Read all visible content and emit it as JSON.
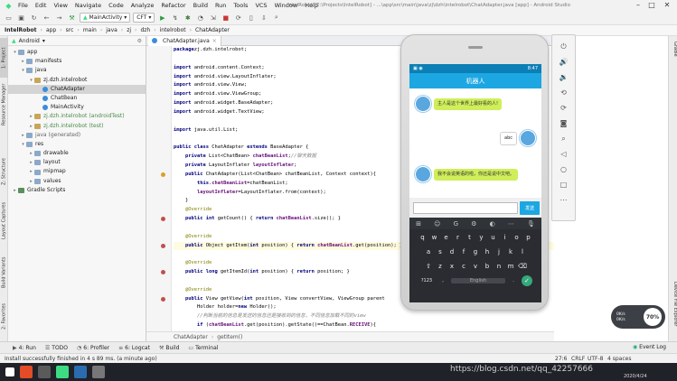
{
  "menu": [
    "File",
    "Edit",
    "View",
    "Navigate",
    "Code",
    "Analyze",
    "Refactor",
    "Build",
    "Run",
    "Tools",
    "VCS",
    "Window",
    "Help"
  ],
  "window_title": "IntelRobot [E:\\Projects\\IntelRobot] - ...\\app\\src\\main\\java\\zj\\dzh\\intelrobot\\ChatAdapter.java [app] - Android Studio",
  "toolbar": {
    "config": "MainActivity",
    "device": "CFT"
  },
  "breadcrumb": [
    "IntelRobot",
    "app",
    "src",
    "main",
    "java",
    "zj",
    "dzh",
    "intelrobot",
    "ChatAdapter"
  ],
  "left_tools": [
    "1: Project",
    "Resource Manager",
    "Z: Structure",
    "Layout Captures",
    "Build Variants",
    "2: Favorites"
  ],
  "right_tools": [
    "Gradle",
    "Device File Explorer"
  ],
  "project": {
    "view": "Android",
    "tree": [
      {
        "label": "app",
        "depth": 0,
        "arrow": "▾",
        "icon": "folder",
        "color": "#222"
      },
      {
        "label": "manifests",
        "depth": 1,
        "arrow": "▸",
        "icon": "folder",
        "color": "#222"
      },
      {
        "label": "java",
        "depth": 1,
        "arrow": "▾",
        "icon": "folder",
        "color": "#222"
      },
      {
        "label": "zj.dzh.intelrobot",
        "depth": 2,
        "arrow": "▾",
        "icon": "package",
        "color": "#222"
      },
      {
        "label": "ChatAdapter",
        "depth": 3,
        "arrow": "",
        "icon": "class",
        "color": "#222",
        "selected": true
      },
      {
        "label": "ChatBean",
        "depth": 3,
        "arrow": "",
        "icon": "class",
        "color": "#222"
      },
      {
        "label": "MainActivity",
        "depth": 3,
        "arrow": "",
        "icon": "class",
        "color": "#222"
      },
      {
        "label": "zj.dzh.intelrobot (androidTest)",
        "depth": 2,
        "arrow": "▸",
        "icon": "package",
        "color": "#222"
      },
      {
        "label": "zj.dzh.intelrobot (test)",
        "depth": 2,
        "arrow": "▸",
        "icon": "package",
        "color": "#222"
      },
      {
        "label": "java (generated)",
        "depth": 1,
        "arrow": "▸",
        "icon": "folder",
        "color": "#222"
      },
      {
        "label": "res",
        "depth": 1,
        "arrow": "▾",
        "icon": "folder",
        "color": "#222"
      },
      {
        "label": "drawable",
        "depth": 2,
        "arrow": "▸",
        "icon": "folder",
        "color": "#222"
      },
      {
        "label": "layout",
        "depth": 2,
        "arrow": "▸",
        "icon": "folder",
        "color": "#222"
      },
      {
        "label": "mipmap",
        "depth": 2,
        "arrow": "▸",
        "icon": "folder",
        "color": "#222"
      },
      {
        "label": "values",
        "depth": 2,
        "arrow": "▸",
        "icon": "folder",
        "color": "#222"
      },
      {
        "label": "Gradle Scripts",
        "depth": 0,
        "arrow": "▸",
        "icon": "gradle",
        "color": "#222"
      }
    ]
  },
  "editor": {
    "tab": "ChatAdapter.java",
    "bottom_crumb": [
      "ChatAdapter",
      "getItem()"
    ],
    "lines": [
      [
        [
          "kw",
          "package"
        ],
        [
          "",
          "zj.dzh.intelrobot;"
        ]
      ],
      [
        [
          "",
          ""
        ]
      ],
      [
        [
          "kw",
          "import"
        ],
        [
          "",
          " android.content.Context;"
        ]
      ],
      [
        [
          "kw",
          "import"
        ],
        [
          "",
          " android.view.LayoutInflater;"
        ]
      ],
      [
        [
          "kw",
          "import"
        ],
        [
          "",
          " android.view.View;"
        ]
      ],
      [
        [
          "kw",
          "import"
        ],
        [
          "",
          " android.view.ViewGroup;"
        ]
      ],
      [
        [
          "kw",
          "import"
        ],
        [
          "",
          " android.widget.BaseAdapter;"
        ]
      ],
      [
        [
          "kw",
          "import"
        ],
        [
          "",
          " android.widget.TextView;"
        ]
      ],
      [
        [
          "",
          ""
        ]
      ],
      [
        [
          "kw",
          "import"
        ],
        [
          "",
          " java.util.List;"
        ]
      ],
      [
        [
          "",
          ""
        ]
      ],
      [
        [
          "kw",
          "public class"
        ],
        [
          "",
          " ChatAdapter "
        ],
        [
          "kw",
          "extends"
        ],
        [
          "",
          " BaseAdapter {"
        ]
      ],
      [
        [
          "",
          "    "
        ],
        [
          "kw",
          "private"
        ],
        [
          "",
          " List<ChatBean> "
        ],
        [
          "fld",
          "chatBeanList"
        ],
        [
          ";"
        ],
        [
          "cmt",
          "//聊天数据"
        ]
      ],
      [
        [
          "",
          "    "
        ],
        [
          "kw",
          "private"
        ],
        [
          "",
          " LayoutInflater "
        ],
        [
          "fld",
          "layoutInflater"
        ],
        [
          "",
          ";"
        ]
      ],
      [
        [
          "",
          "    "
        ],
        [
          "kw",
          "public"
        ],
        [
          "",
          " ChatAdapter(List<ChatBean> chatBeanList, Context context){"
        ]
      ],
      [
        [
          "",
          "        "
        ],
        [
          "kw",
          "this"
        ],
        [
          "",
          "."
        ],
        [
          "fld",
          "chatBeanList"
        ],
        [
          "",
          "=chatBeanList;"
        ]
      ],
      [
        [
          "",
          "        "
        ],
        [
          "fld",
          "layoutInflater"
        ],
        [
          "",
          "=LayoutInflater."
        ],
        [
          "",
          "from(context);"
        ]
      ],
      [
        [
          "",
          "    }"
        ]
      ],
      [
        [
          "",
          "    "
        ],
        [
          "ann",
          "@Override"
        ]
      ],
      [
        [
          "",
          "    "
        ],
        [
          "kw",
          "public int"
        ],
        [
          "",
          " getCount() { "
        ],
        [
          "kw",
          "return"
        ],
        [
          "",
          " "
        ],
        [
          "fld",
          "chatBeanList"
        ],
        [
          "",
          ".size(); }"
        ]
      ],
      [
        [
          "",
          ""
        ]
      ],
      [
        [
          "",
          "    "
        ],
        [
          "ann",
          "@Override"
        ]
      ],
      [
        [
          "",
          "    "
        ],
        [
          "kw",
          "public"
        ],
        [
          "",
          " Object getItem("
        ],
        [
          "kw",
          "int"
        ],
        [
          "",
          " position) { "
        ],
        [
          "kw",
          "return"
        ],
        [
          "",
          " "
        ],
        [
          "fld",
          "chatBeanList"
        ],
        [
          "",
          ".get(position); }"
        ]
      ],
      [
        [
          "",
          ""
        ]
      ],
      [
        [
          "",
          "    "
        ],
        [
          "ann",
          "@Override"
        ]
      ],
      [
        [
          "",
          "    "
        ],
        [
          "kw",
          "public long"
        ],
        [
          "",
          " getItemId("
        ],
        [
          "kw",
          "int"
        ],
        [
          "",
          " position) { "
        ],
        [
          "kw",
          "return"
        ],
        [
          "",
          " position; }"
        ]
      ],
      [
        [
          "",
          ""
        ]
      ],
      [
        [
          "",
          "    "
        ],
        [
          "ann",
          "@Override"
        ]
      ],
      [
        [
          "",
          "    "
        ],
        [
          "kw",
          "public"
        ],
        [
          "",
          " View getView("
        ],
        [
          "kw",
          "int"
        ],
        [
          "",
          " position, View convertView, ViewGroup parent"
        ]
      ],
      [
        [
          "",
          "        Holder holder="
        ],
        [
          "kw",
          "new"
        ],
        [
          "",
          " Holder();"
        ]
      ],
      [
        [
          "",
          "        "
        ],
        [
          "cmt",
          "//判断当前的信息是发送的信息还是接收到的信息，不同信息加载不同的view"
        ]
      ],
      [
        [
          "",
          "        "
        ],
        [
          "kw",
          "if"
        ],
        [
          "",
          " ("
        ],
        [
          "fld",
          "chatBeanList"
        ],
        [
          "",
          ".get(position).getState()==ChatBean."
        ],
        [
          "fld",
          "RECEIVE"
        ],
        [
          "",
          "){"
        ]
      ]
    ],
    "gutter": [
      {
        "line": 14,
        "icon": "c"
      },
      {
        "line": 19,
        "icon": "o"
      },
      {
        "line": 22,
        "icon": "o"
      },
      {
        "line": 25,
        "icon": "o"
      },
      {
        "line": 28,
        "icon": "o"
      }
    ]
  },
  "bottom_tools": [
    "4: Run",
    "TODO",
    "6: Profiler",
    "6: Logcat",
    "Build",
    "Terminal"
  ],
  "event_log": "Event Log",
  "status": {
    "message": "Install successfully finished in 4 s 89 ms. (a minute ago)",
    "position": "27:6",
    "line_sep": "CRLF",
    "encoding": "UTF-8",
    "indent": "4 spaces"
  },
  "taskbar": {
    "date": "2020/4/24",
    "watermark": "https://blog.csdn.net/qq_42257666"
  },
  "phone": {
    "status_time": "8:47",
    "app_title": "机器人",
    "messages": [
      {
        "side": "left",
        "text": "主人是这个世界上最好看的人!",
        "style": "g"
      },
      {
        "side": "right",
        "text": "abc",
        "style": "w"
      },
      {
        "side": "left",
        "text": "我不会说英语的啦，你还是说中文吧。",
        "style": "g"
      }
    ],
    "send_label": "发送",
    "kb_rows": [
      [
        "q",
        "w",
        "e",
        "r",
        "t",
        "y",
        "u",
        "i",
        "o",
        "p"
      ],
      [
        "a",
        "s",
        "d",
        "f",
        "g",
        "h",
        "j",
        "k",
        "l"
      ],
      [
        "⇧",
        "z",
        "x",
        "c",
        "v",
        "b",
        "n",
        "m",
        "⌫"
      ]
    ],
    "kb_bottom": {
      "sym": "?123",
      "comma": ",",
      "space": "English",
      "dot": "."
    }
  },
  "net_widget": {
    "speed": "70%",
    "up": "0K/s",
    "down": "0K/s"
  }
}
